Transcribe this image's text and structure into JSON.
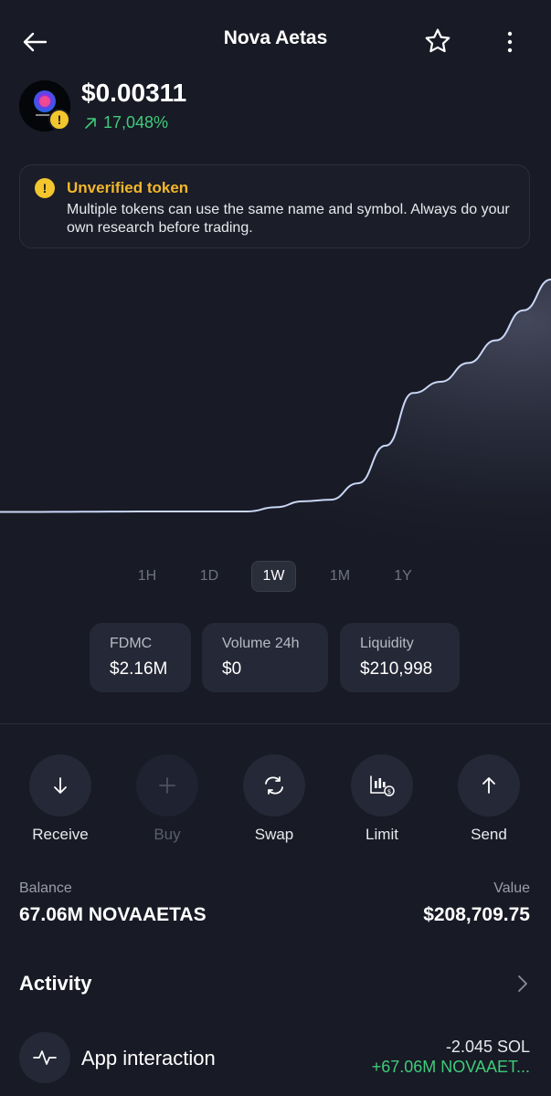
{
  "header": {
    "title": "Nova Aetas"
  },
  "token": {
    "price": "$0.00311",
    "change": "17,048%",
    "change_color": "#3fcb7a"
  },
  "warning": {
    "title": "Unverified token",
    "text": "Multiple tokens can use the same name and symbol. Always do your own research before trading.",
    "icon": "!"
  },
  "chart_data": {
    "type": "area",
    "x": [
      0,
      1,
      2,
      3,
      4,
      5,
      6,
      7,
      8,
      9,
      10,
      11,
      12,
      13,
      14,
      15,
      16,
      17,
      18,
      19,
      20
    ],
    "series": [
      {
        "values": [
          1.8e-05,
          1.8e-05,
          1.9e-05,
          2.1e-05,
          2.3e-05,
          2.4e-05,
          2.5e-05,
          2.4e-05,
          2.4e-05,
          2.5e-05,
          8e-05,
          0.00016,
          0.00018,
          0.0004,
          0.0009,
          0.0016,
          0.00175,
          0.002,
          0.0023,
          0.0027,
          0.00311
        ]
      }
    ],
    "line_color": "#c9d6f5",
    "grid": false
  },
  "timeframes": [
    "1H",
    "1D",
    "1W",
    "1M",
    "1Y"
  ],
  "timeframe_selected": "1W",
  "stats": [
    {
      "label": "FDMC",
      "value": "$2.16M"
    },
    {
      "label": "Volume 24h",
      "value": "$0"
    },
    {
      "label": "Liquidity",
      "value": "$210,998"
    }
  ],
  "actions": {
    "receive": "Receive",
    "buy": "Buy",
    "swap": "Swap",
    "limit": "Limit",
    "send": "Send"
  },
  "balance": {
    "label": "Balance",
    "value": "67.06M NOVAAETAS",
    "value_label": "Value",
    "value_amount": "$208,709.75"
  },
  "activity": {
    "title": "Activity",
    "items": [
      {
        "title": "App interaction",
        "amount_out": "-2.045 SOL",
        "amount_in": "+67.06M NOVAAET..."
      }
    ]
  }
}
